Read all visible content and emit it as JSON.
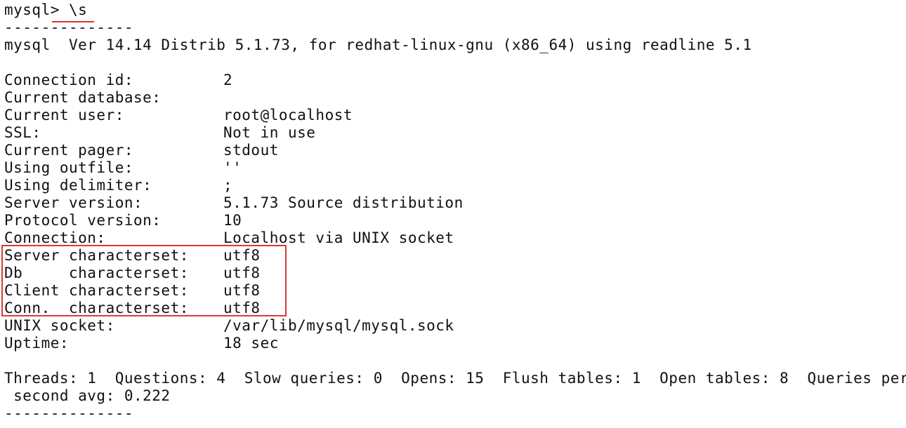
{
  "terminal": {
    "prompt": "mysql>",
    "command": "\\s",
    "separator_top": "--------------",
    "version_line": "mysql  Ver 14.14 Distrib 5.1.73, for redhat-linux-gnu (x86_64) using readline 5.1",
    "status_rows": [
      {
        "label": "Connection id:",
        "value": "2"
      },
      {
        "label": "Current database:",
        "value": ""
      },
      {
        "label": "Current user:",
        "value": "root@localhost"
      },
      {
        "label": "SSL:",
        "value": "Not in use"
      },
      {
        "label": "Current pager:",
        "value": "stdout"
      },
      {
        "label": "Using outfile:",
        "value": "''"
      },
      {
        "label": "Using delimiter:",
        "value": ";"
      },
      {
        "label": "Server version:",
        "value": "5.1.73 Source distribution"
      },
      {
        "label": "Protocol version:",
        "value": "10"
      },
      {
        "label": "Connection:",
        "value": "Localhost via UNIX socket"
      },
      {
        "label": "Server characterset:",
        "value": "utf8"
      },
      {
        "label": "Db     characterset:",
        "value": "utf8"
      },
      {
        "label": "Client characterset:",
        "value": "utf8"
      },
      {
        "label": "Conn.  characterset:",
        "value": "utf8"
      },
      {
        "label": "UNIX socket:",
        "value": "/var/lib/mysql/mysql.sock"
      },
      {
        "label": "Uptime:",
        "value": "18 sec"
      }
    ],
    "stats_line_1": "Threads: 1  Questions: 4  Slow queries: 0  Opens: 15  Flush tables: 1  Open tables: 8  Queries per",
    "stats_line_2": " second avg: 0.222",
    "separator_bottom": "--------------"
  },
  "annotations": {
    "highlight_color": "#d83a3a",
    "underline_color": "#e03030"
  }
}
